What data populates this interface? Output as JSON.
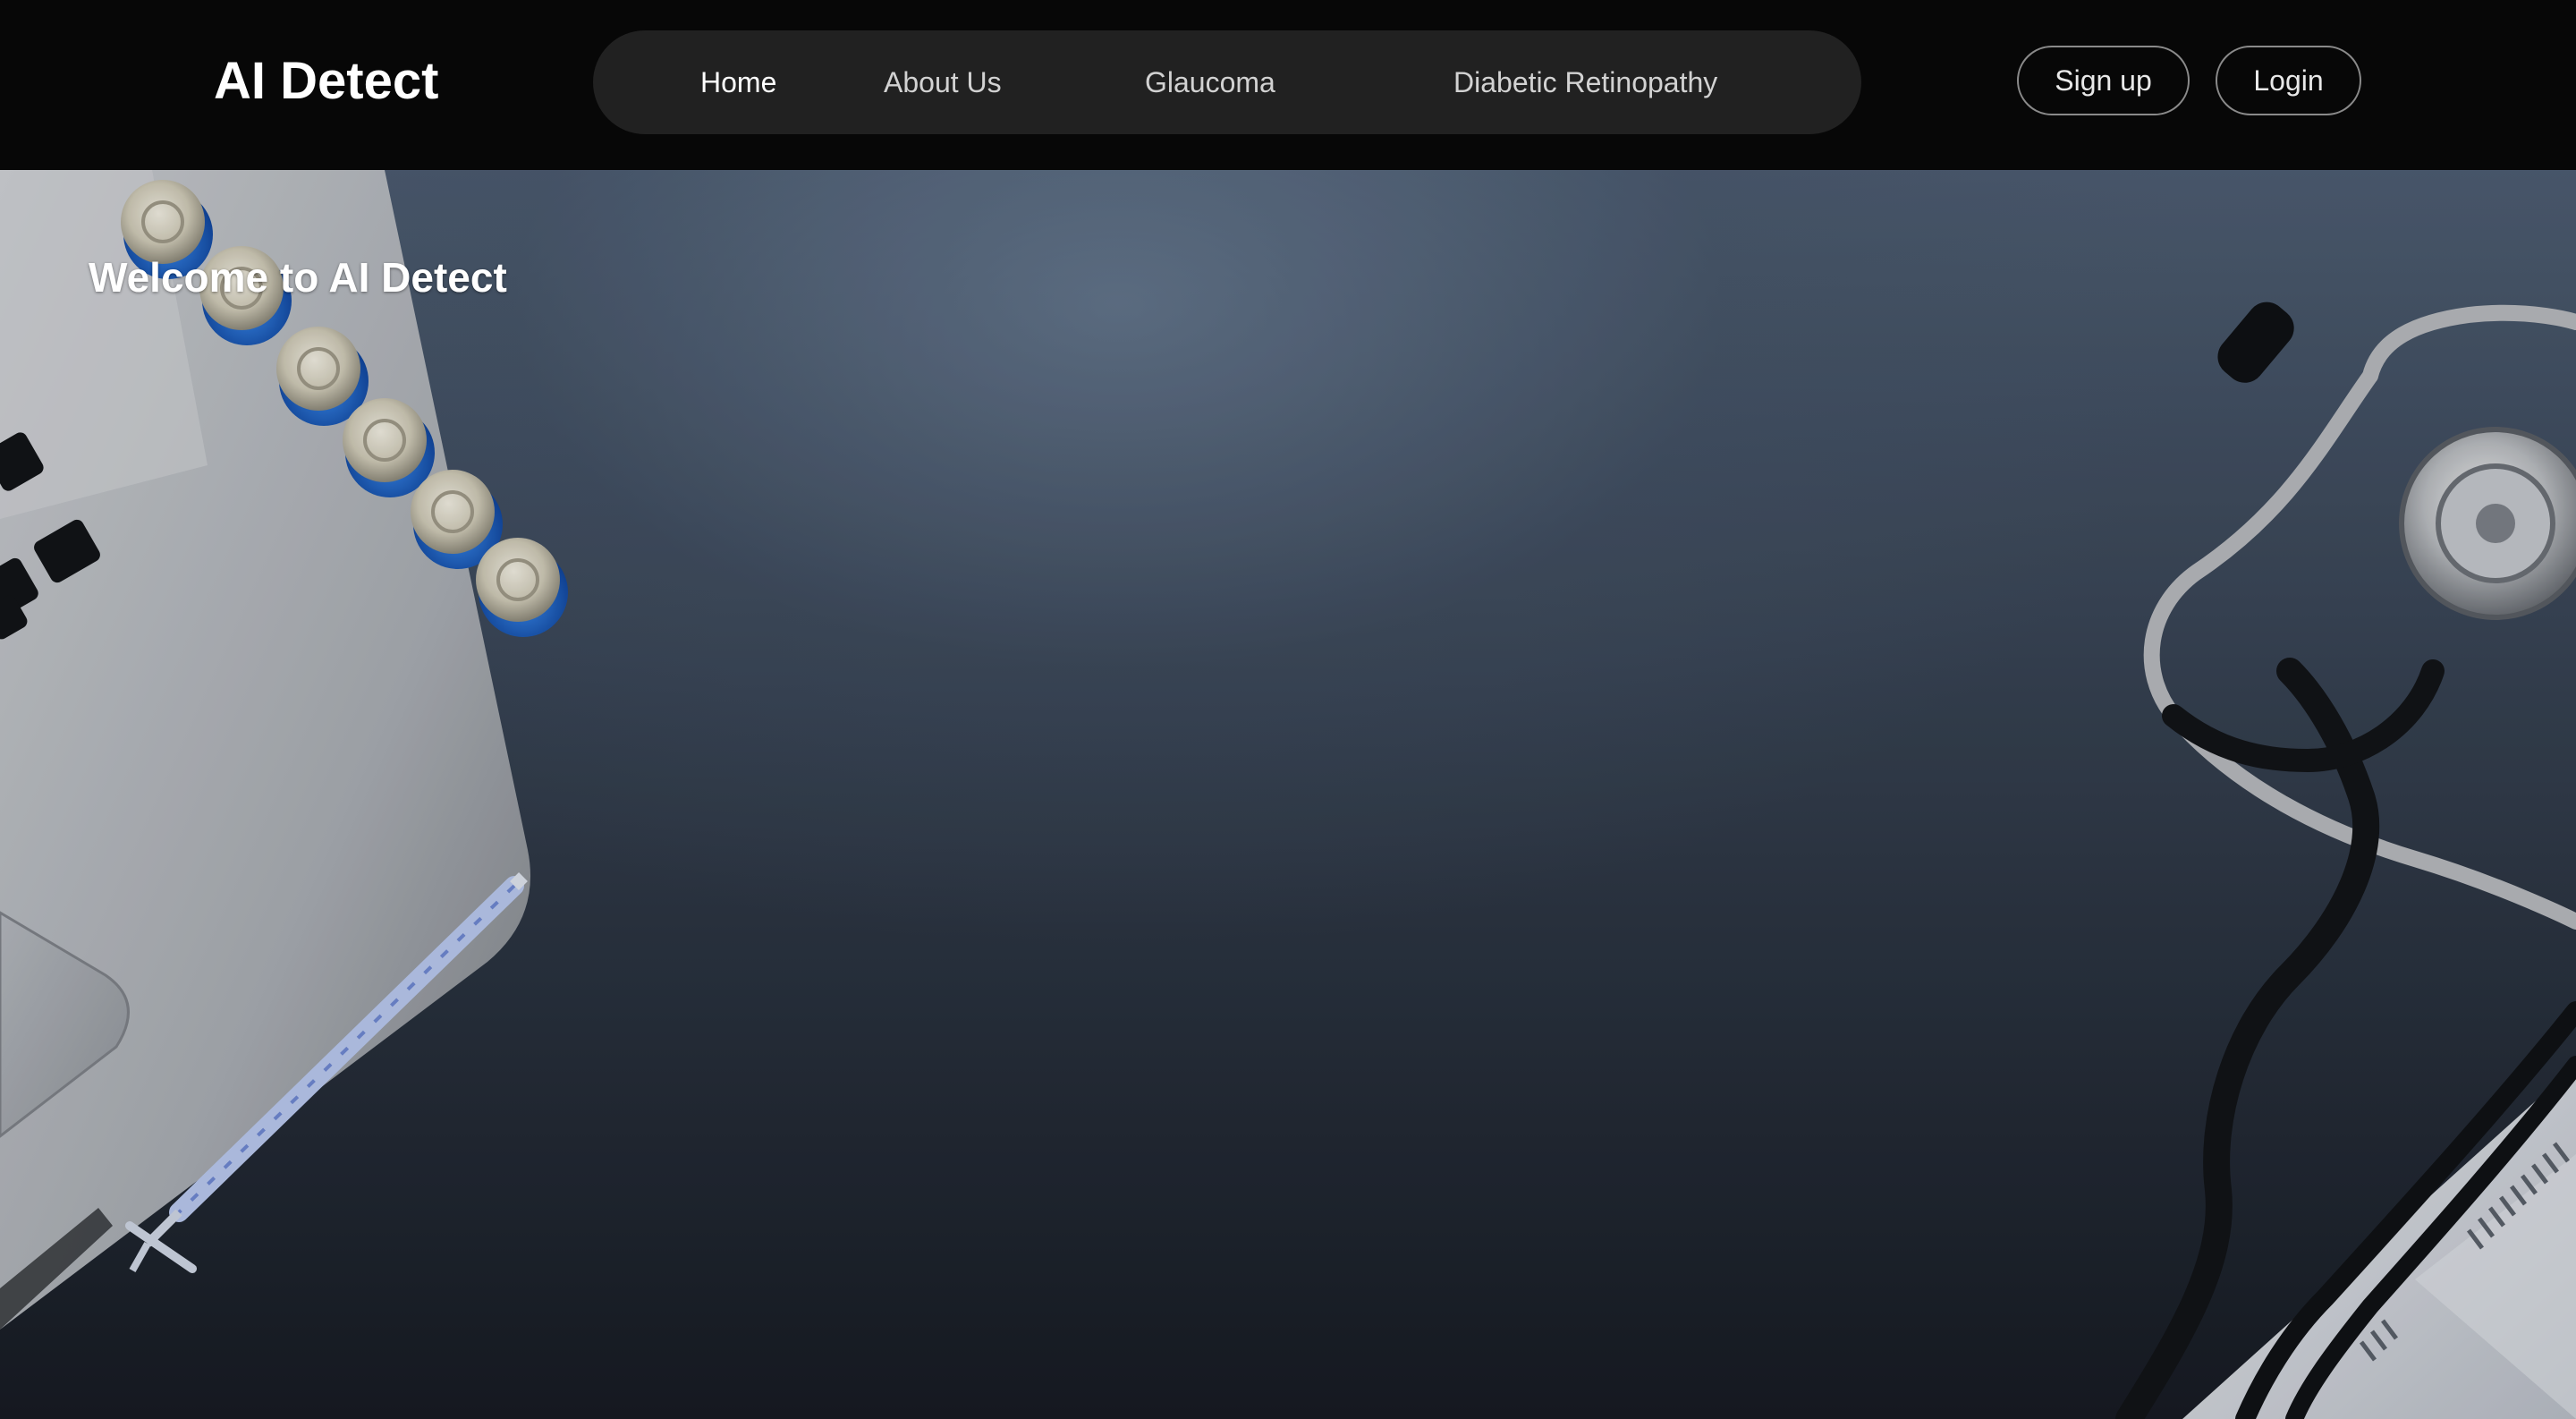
{
  "brand": {
    "name": "AI Detect"
  },
  "nav": {
    "items": [
      {
        "label": "Home",
        "active": true
      },
      {
        "label": "About Us",
        "active": false
      },
      {
        "label": "Glaucoma",
        "active": false
      },
      {
        "label": "Diabetic Retinopathy",
        "active": false
      }
    ]
  },
  "auth": {
    "signup_label": "Sign up",
    "login_label": "Login"
  },
  "hero": {
    "title": "Welcome to AI Detect",
    "background_scene": [
      "laptop",
      "medicine-vials",
      "syringe",
      "stethoscope",
      "medical-report"
    ]
  },
  "colors": {
    "topbar_bg": "#070707",
    "nav_pill_bg": "#212121",
    "text_primary": "#ffffff",
    "button_border": "#8a8a8a"
  }
}
